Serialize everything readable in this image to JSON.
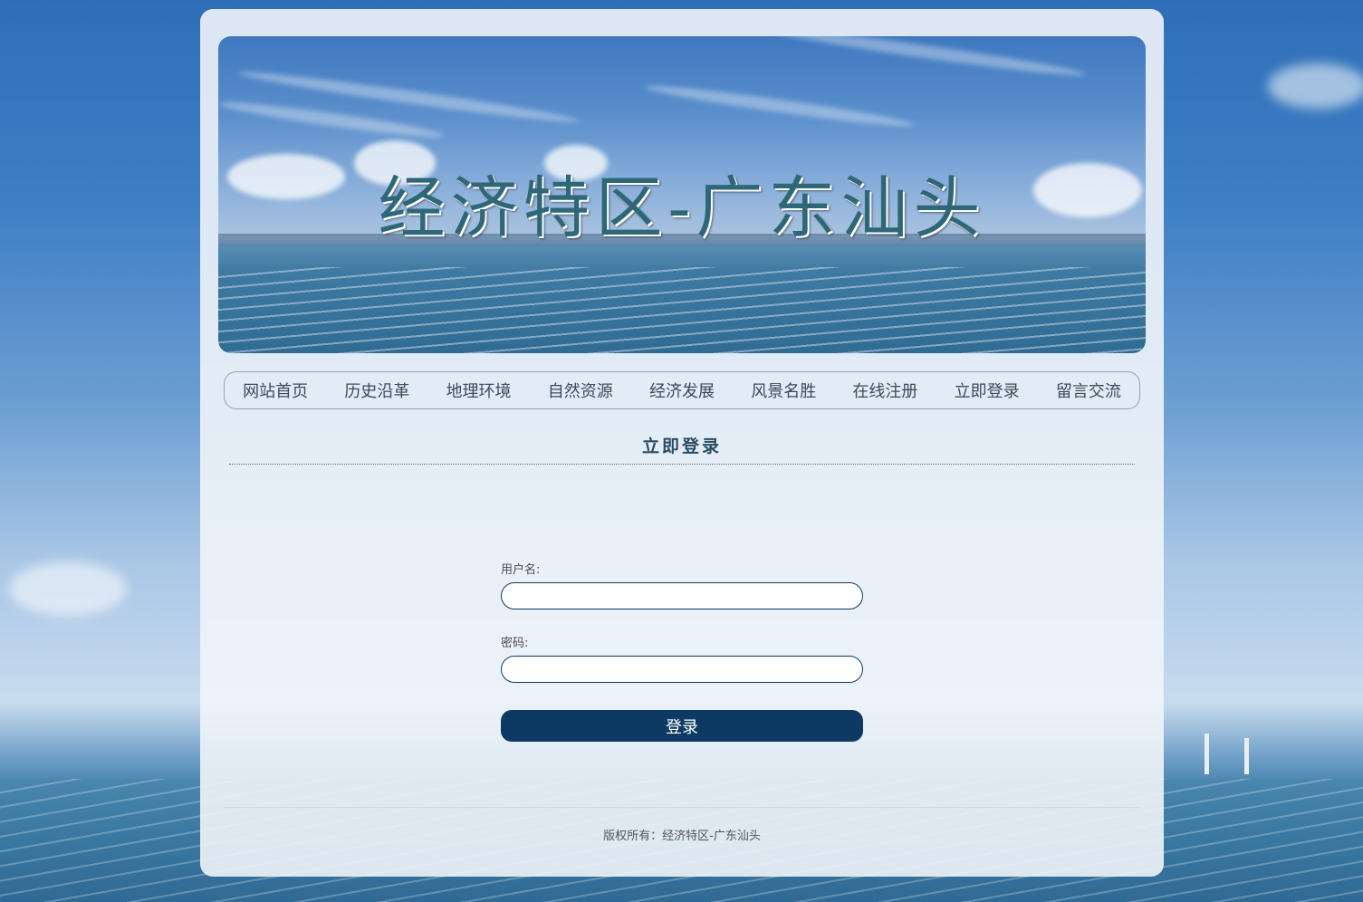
{
  "banner": {
    "title": "经济特区-广东汕头"
  },
  "nav": {
    "items": [
      "网站首页",
      "历史沿革",
      "地理环境",
      "自然资源",
      "经济发展",
      "风景名胜",
      "在线注册",
      "立即登录",
      "留言交流"
    ]
  },
  "section": {
    "title": "立即登录"
  },
  "form": {
    "username_label": "用户名:",
    "username_value": "",
    "password_label": "密码:",
    "password_value": "",
    "submit_label": "登录"
  },
  "footer": {
    "text": "版权所有：经济特区-广东汕头"
  },
  "colors": {
    "accent": "#0c3a62",
    "nav_text": "#3a4b5c",
    "title": "#2e6777"
  }
}
